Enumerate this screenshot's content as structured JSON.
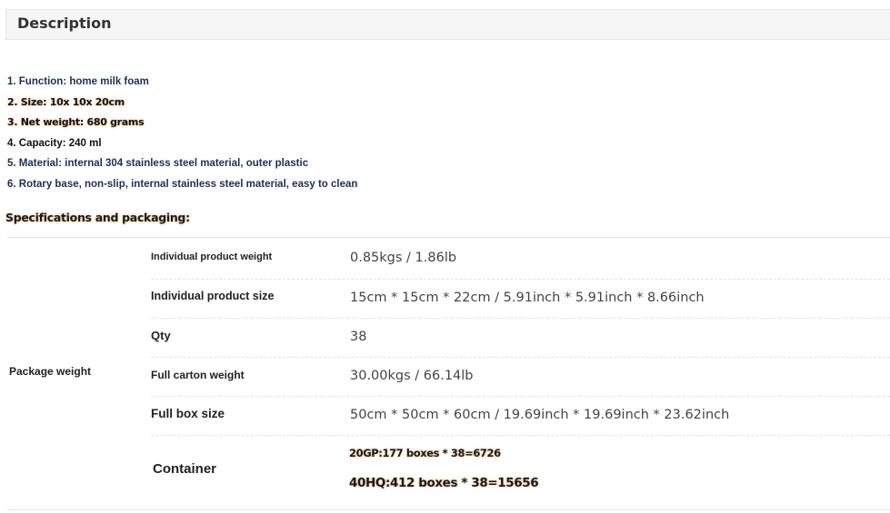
{
  "description": {
    "title": "Description"
  },
  "features": [
    "1. Function: home milk foam",
    "2. Size: 10x 10x 20cm",
    "3. Net weight: 680 grams",
    "4. Capacity: 240 ml",
    "5. Material: internal 304 stainless steel material, outer plastic",
    "6. Rotary base, non-slip, internal stainless steel material, easy to clean"
  ],
  "specifications": {
    "heading": "Specifications and packaging:",
    "group_label": "Package weight",
    "rows": [
      {
        "label": "Individual product weight",
        "value": "0.85kgs / 1.86lb"
      },
      {
        "label": "Individual product size",
        "value": "15cm * 15cm * 22cm / 5.91inch * 5.91inch * 8.66inch"
      },
      {
        "label": "Qty",
        "value": "38"
      },
      {
        "label": "Full carton weight",
        "value": "30.00kgs / 66.14lb"
      },
      {
        "label": "Full box size",
        "value": "50cm * 50cm * 60cm / 19.69inch * 19.69inch * 23.62inch"
      }
    ],
    "container": {
      "label": "Container",
      "lines": [
        "20GP:177 boxes * 38=6726",
        "40HQ:412 boxes * 38=15656"
      ]
    }
  }
}
